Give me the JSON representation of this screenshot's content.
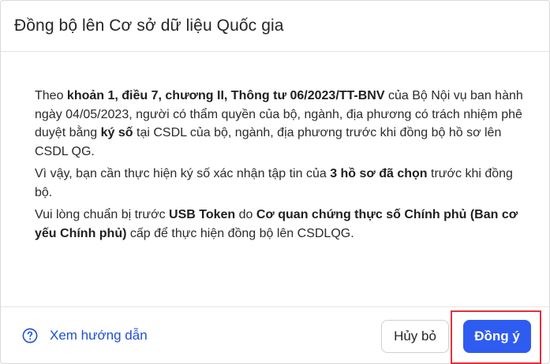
{
  "dialog": {
    "title": "Đồng bộ lên Cơ sở dữ liệu Quốc gia"
  },
  "content": {
    "p1_a": "Theo ",
    "p1_b": "khoản 1, điều 7, chương II, Thông tư 06/2023/TT-BNV",
    "p1_c": " của Bộ Nội vụ ban hành ngày 04/05/2023, người có thẩm quyền của bộ, ngành, địa phương có trách nhiệm phê duyệt bằng ",
    "p1_d": "ký số",
    "p1_e": " tại CSDL của bộ, ngành, địa phương trước khi đồng bộ hồ sơ lên CSDL QG.",
    "p2_a": "Vì vậy, bạn cần thực hiện ký số xác nhận tập tin của ",
    "p2_b": "3 hồ sơ đã chọn",
    "p2_c": " trước khi đồng bộ.",
    "p3_a": "Vui lòng chuẩn bị trước ",
    "p3_b": "USB Token",
    "p3_c": " do ",
    "p3_d": "Cơ quan chứng thực số Chính phủ (Ban cơ yếu Chính phủ)",
    "p3_e": " cấp để thực hiện đồng bộ lên CSDLQG."
  },
  "footer": {
    "help_link": "Xem hướng dẫn",
    "help_icon": "help-circle-icon",
    "cancel_label": "Hủy bỏ",
    "ok_label": "Đồng ý"
  },
  "colors": {
    "primary": "#2f5cf0",
    "link": "#1d4fd8",
    "highlight": "#e0323a"
  }
}
